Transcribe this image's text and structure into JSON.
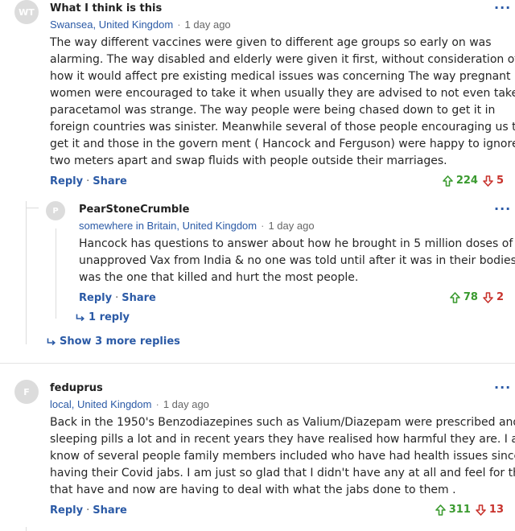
{
  "comments": [
    {
      "avatar_initials": "WT",
      "author": "What I think is this",
      "location": "Swansea, United Kingdom",
      "time": "1 day ago",
      "body_lines": [
        "The way different vaccines were given to different age groups so early on was",
        "alarming. The way disabled and elderly were given it first, without consideration of",
        "how it would affect pre existing medical issues was concerning The way pregnant",
        "women were encouraged to take it when usually they are advised to not even take",
        "paracetamol was strange. The way people were being chased  down to get it in",
        "foreign countries was sinister. Meanwhile several of those people encouraging us to",
        "get it and those in the govern ment ( Hancock and Ferguson) were happy to ignore",
        "two meters apart and swap fluids with people outside their marriages."
      ],
      "reply_label": "Reply",
      "share_label": "Share",
      "upvotes": "224",
      "downvotes": "5",
      "replies": [
        {
          "avatar_initials": "P",
          "author": "PearStoneCrumble",
          "location": "somewhere in Britain, United Kingdom",
          "time": "1 day ago",
          "body_lines": [
            "Hancock has questions to answer about how he brought in 5 million doses of an",
            "unapproved Vax from India & no one was told until after it was in their bodies. It",
            "was the one that killed and hurt the most people."
          ],
          "reply_label": "Reply",
          "share_label": "Share",
          "upvotes": "78",
          "downvotes": "2",
          "reply_count_label": "1 reply"
        }
      ],
      "show_more_label": "Show 3 more replies"
    },
    {
      "avatar_initials": "F",
      "author": "feduprus",
      "location": "local, United Kingdom",
      "time": "1 day ago",
      "body_lines": [
        "Back in the 1950's Benzodiazepines such as Valium/Diazepam were prescribed and",
        "sleeping pills a lot and in recent years they have realised how harmful they are. I also",
        "know of several people family members included who have had health issues since",
        "having their Covid jabs. I am just so glad that I didn't have any at all and feel for those",
        "that have and now are having to deal with what the jabs done to them ."
      ],
      "reply_label": "Reply",
      "share_label": "Share",
      "upvotes": "311",
      "downvotes": "13"
    }
  ],
  "separator_dot": "·",
  "more_glyph": "···",
  "colors": {
    "link": "#2b5aa6",
    "upvote": "#3a9a2f",
    "downvote": "#c8322c",
    "avatar_bg": "#dcdcdc"
  },
  "icons": {
    "upvote": "arrow-up-icon",
    "downvote": "arrow-down-icon",
    "reply_thread": "reply-arrow-icon",
    "more": "more-options-icon"
  }
}
